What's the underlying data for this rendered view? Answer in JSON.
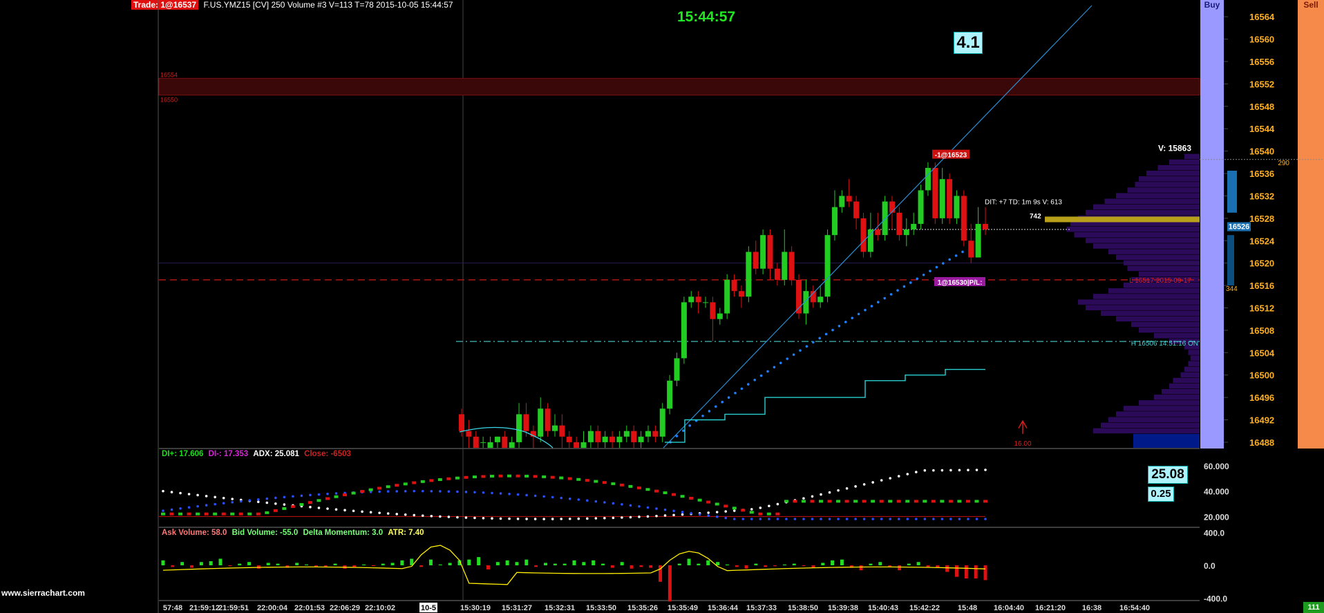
{
  "header": {
    "trade_tag": "Trade: 1@16537",
    "symbol_line": "F.US.YMZ15 [CV]  250 Volume  #3 V=113 T=78 2015-10-05 15:44:57"
  },
  "clock": "15:44:57",
  "badges": {
    "main": "4.1",
    "adx_value": "25.08",
    "adx_small": "0.25"
  },
  "buttons": {
    "buy": "Buy",
    "sell": "Sell"
  },
  "footer": {
    "site": "www.sierrachart.com",
    "corner": "111"
  },
  "levels": {
    "zone_top": "16554",
    "zone_bottom": "16550",
    "low_line": "L 16517  2015-09-17",
    "high_line": "H 16506  14:51:16  ON"
  },
  "annotations": {
    "sell_fill": "-1@16523",
    "position": "1@16530|P/L:",
    "dit": "DIT: +7  TD: 1m 9s  V: 613",
    "small742": "742",
    "volume_total": "V: 15863",
    "arrow_label": "16.00",
    "price_tag": "16526",
    "dom_top": "290",
    "dom_bottom": "344"
  },
  "colors": {
    "bull": "#22cc22",
    "bear": "#dd1111",
    "trendline": "#2a8fd8",
    "psar": "#1e7fff",
    "stop_line": "#2ad0d0",
    "profile": "#2c0a5a",
    "buy_button": "#9999ff",
    "sell_button": "#f58a4a",
    "yellow_bar": "#b8a01a",
    "axis_text": "#ffb020"
  },
  "chart_data": [
    {
      "type": "candlestick",
      "title": "",
      "price_axis": {
        "ticks": [
          "16564",
          "16560",
          "16556",
          "16552",
          "16548",
          "16544",
          "16540",
          "16536",
          "16532",
          "16528",
          "16524",
          "16520",
          "16516",
          "16512",
          "16508",
          "16504",
          "16500",
          "16496",
          "16492",
          "16488"
        ],
        "ylim": [
          16487,
          16566
        ]
      },
      "time_axis": {
        "ticks": [
          "57:48",
          "21:59:12",
          "21:59:51",
          "22:00:04",
          "22:01:53",
          "22:06:29",
          "22:10:02",
          "10-5",
          "15:30:19",
          "15:31:27",
          "15:32:31",
          "15:33:50",
          "15:35:26",
          "15:35:49",
          "15:36:44",
          "15:37:33",
          "15:38:50",
          "15:39:38",
          "15:40:43",
          "15:42:22",
          "15:48",
          "16:04:40",
          "16:21:20",
          "16:38",
          "16:54:40"
        ]
      },
      "candles": [
        [
          16493,
          16490,
          16494,
          16489
        ],
        [
          16490,
          16489,
          16492,
          16487
        ],
        [
          16489,
          16487,
          16490,
          16486
        ],
        [
          16488,
          16488,
          16489,
          16486
        ],
        [
          16487,
          16488,
          16489,
          16486
        ],
        [
          16488,
          16489,
          16489,
          16487
        ],
        [
          16489,
          16487,
          16490,
          16486
        ],
        [
          16487,
          16488,
          16489,
          16486
        ],
        [
          16488,
          16493,
          16495,
          16487
        ],
        [
          16493,
          16490,
          16495,
          16489
        ],
        [
          16490,
          16489,
          16491,
          16487
        ],
        [
          16489,
          16494,
          16496,
          16488
        ],
        [
          16494,
          16490,
          16495,
          16489
        ],
        [
          16490,
          16491,
          16493,
          16489
        ],
        [
          16491,
          16489,
          16493,
          16487
        ],
        [
          16489,
          16488,
          16490,
          16486
        ],
        [
          16488,
          16487,
          16489,
          16485
        ],
        [
          16487,
          16488,
          16490,
          16486
        ],
        [
          16488,
          16490,
          16491,
          16487
        ],
        [
          16490,
          16488,
          16491,
          16486
        ],
        [
          16488,
          16489,
          16490,
          16487
        ],
        [
          16489,
          16488,
          16490,
          16487
        ],
        [
          16488,
          16489,
          16490,
          16487
        ],
        [
          16489,
          16490,
          16491,
          16488
        ],
        [
          16490,
          16488,
          16491,
          16487
        ],
        [
          16488,
          16489,
          16490,
          16487
        ],
        [
          16489,
          16490,
          16491,
          16488
        ],
        [
          16490,
          16489,
          16491,
          16488
        ],
        [
          16489,
          16494,
          16495,
          16488
        ],
        [
          16494,
          16499,
          16500,
          16493
        ],
        [
          16499,
          16503,
          16504,
          16498
        ],
        [
          16503,
          16513,
          16514,
          16502
        ],
        [
          16513,
          16514,
          16515,
          16512
        ],
        [
          16514,
          16513,
          16515,
          16511
        ],
        [
          16513,
          16513,
          16514,
          16512
        ],
        [
          16513,
          16510,
          16514,
          16506
        ],
        [
          16510,
          16511,
          16512,
          16509
        ],
        [
          16511,
          16517,
          16518,
          16510
        ],
        [
          16517,
          16515,
          16518,
          16514
        ],
        [
          16515,
          16514,
          16516,
          16512
        ],
        [
          16514,
          16522,
          16523,
          16513
        ],
        [
          16522,
          16519,
          16524,
          16518
        ],
        [
          16519,
          16525,
          16526,
          16518
        ],
        [
          16525,
          16519,
          16526,
          16517
        ],
        [
          16519,
          16517,
          16520,
          16516
        ],
        [
          16517,
          16522,
          16526,
          16516
        ],
        [
          16522,
          16517,
          16523,
          16516
        ],
        [
          16517,
          16511,
          16518,
          16510
        ],
        [
          16511,
          16515,
          16517,
          16509
        ],
        [
          16515,
          16513,
          16516,
          16512
        ],
        [
          16513,
          16514,
          16516,
          16512
        ],
        [
          16514,
          16525,
          16526,
          16513
        ],
        [
          16525,
          16530,
          16533,
          16524
        ],
        [
          16530,
          16532,
          16533,
          16529
        ],
        [
          16532,
          16531,
          16535,
          16530
        ],
        [
          16531,
          16528,
          16532,
          16526
        ],
        [
          16528,
          16522,
          16529,
          16521
        ],
        [
          16522,
          16526,
          16529,
          16521
        ],
        [
          16526,
          16525,
          16529,
          16524
        ],
        [
          16525,
          16531,
          16532,
          16524
        ],
        [
          16531,
          16529,
          16532,
          16526
        ],
        [
          16529,
          16525,
          16530,
          16524
        ],
        [
          16525,
          16526,
          16528,
          16523
        ],
        [
          16526,
          16527,
          16529,
          16525
        ],
        [
          16527,
          16533,
          16534,
          16526
        ],
        [
          16533,
          16537,
          16538,
          16532
        ],
        [
          16537,
          16528,
          16538,
          16527
        ],
        [
          16528,
          16535,
          16537,
          16527
        ],
        [
          16535,
          16528,
          16536,
          16527
        ],
        [
          16528,
          16532,
          16533,
          16527
        ],
        [
          16532,
          16524,
          16533,
          16523
        ],
        [
          16524,
          16521,
          16527,
          16520
        ],
        [
          16521,
          16527,
          16530,
          16521
        ],
        [
          16527,
          16526,
          16530,
          16525
        ]
      ],
      "psar_range": [
        16488,
        16522
      ],
      "trendline_range": [
        16487,
        16566
      ],
      "stop_steps": [
        16488,
        16492,
        16492,
        16493,
        16493,
        16496,
        16496,
        16496,
        16496,
        16496,
        16499,
        16499,
        16500,
        16500,
        16501,
        16501
      ]
    },
    {
      "type": "line",
      "title": "DI / ADX",
      "legend": [
        {
          "name": "DI+",
          "value": "17.606",
          "color": "#22dd22"
        },
        {
          "name": "DI-",
          "value": "17.353",
          "color": "#dd22dd"
        },
        {
          "name": "ADX",
          "value": "25.081",
          "color": "#ffffff"
        },
        {
          "name": "Close",
          "value": "-6503",
          "color": "#cc2222"
        }
      ],
      "y_ticks": [
        "60.000",
        "40.000",
        "20.000"
      ],
      "ylim": [
        12,
        72
      ],
      "reference_line": 20
    },
    {
      "type": "bar",
      "title": "Volume / Delta",
      "legend": [
        {
          "name": "Ask Volume",
          "value": "58.0",
          "color": "#ff7777"
        },
        {
          "name": "Bid Volume",
          "value": "-55.0",
          "color": "#77ff77"
        },
        {
          "name": "Delta Momentum",
          "value": "3.0",
          "color": "#77ff77"
        },
        {
          "name": "ATR",
          "value": "7.40",
          "color": "#ffff55"
        }
      ],
      "y_ticks": [
        "400.0",
        "0.0",
        "-400.0"
      ],
      "ylim": [
        -420,
        420
      ],
      "delta": [
        60,
        -20,
        40,
        -30,
        40,
        50,
        80,
        -10,
        20,
        40,
        -40,
        30,
        20,
        -30,
        30,
        10,
        -20,
        -20,
        20,
        -40,
        -20,
        10,
        -10,
        20,
        30,
        60,
        80,
        -20,
        70,
        10,
        30,
        60,
        70,
        100,
        -50,
        40,
        60,
        40,
        70,
        -20,
        30,
        20,
        20,
        60,
        40,
        60,
        20,
        -30,
        40,
        -40,
        -20,
        -30,
        -200,
        -440,
        20,
        80,
        20,
        60,
        40,
        10,
        -20,
        -40,
        20,
        -20,
        -10,
        10,
        20,
        -10,
        -30,
        30,
        60,
        70,
        -30,
        -60,
        20,
        40,
        -20,
        -60,
        20,
        40,
        -20,
        -30,
        -80,
        -140,
        -160,
        -160,
        -180
      ]
    }
  ]
}
